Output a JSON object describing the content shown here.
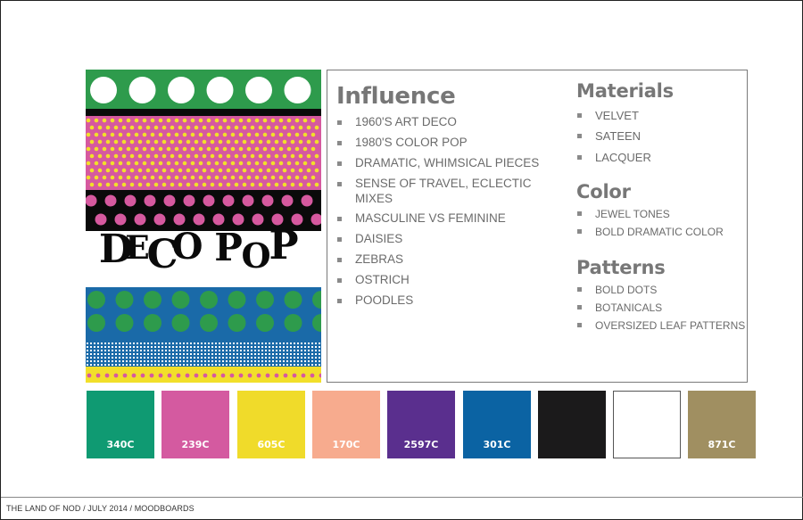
{
  "artwork": {
    "title_letters": [
      "D",
      "E",
      "C",
      "O",
      " ",
      "P",
      "O",
      "P"
    ],
    "colors": {
      "green": "#2e9b4c",
      "pink": "#d6599f",
      "yellow": "#f2df2a",
      "black": "#0a0a0a",
      "blue": "#1a6aa8",
      "white": "#ffffff"
    }
  },
  "influence": {
    "heading": "Influence",
    "items": [
      "1960'S ART DECO",
      "1980'S COLOR POP",
      "DRAMATIC, WHIMSICAL PIECES",
      "SENSE OF TRAVEL, ECLECTIC MIXES",
      "MASCULINE VS FEMININE",
      "DAISIES",
      "ZEBRAS",
      "OSTRICH",
      "POODLES"
    ]
  },
  "materials": {
    "heading": "Materials",
    "items": [
      "VELVET",
      "SATEEN",
      "LACQUER"
    ]
  },
  "color_section": {
    "heading": "Color",
    "items": [
      "JEWEL TONES",
      "BOLD DRAMATIC COLOR"
    ]
  },
  "patterns": {
    "heading": "Patterns",
    "items": [
      "BOLD DOTS",
      "BOTANICALS",
      "OVERSIZED LEAF PATTERNS"
    ]
  },
  "swatches": [
    {
      "code": "340C",
      "color": "#0f9a72"
    },
    {
      "code": "239C",
      "color": "#d45aa0"
    },
    {
      "code": "605C",
      "color": "#f0db2a"
    },
    {
      "code": "170C",
      "color": "#f7ab8e"
    },
    {
      "code": "2597C",
      "color": "#5a2f8e"
    },
    {
      "code": "301C",
      "color": "#0b63a3"
    },
    {
      "code": "",
      "color": "#1b1a1b"
    },
    {
      "code": "",
      "color": "#ffffff"
    },
    {
      "code": "871C",
      "color": "#a08f61"
    }
  ],
  "footer": {
    "text": "THE LAND OF NOD / JULY 2014 / MOODBOARDS"
  }
}
